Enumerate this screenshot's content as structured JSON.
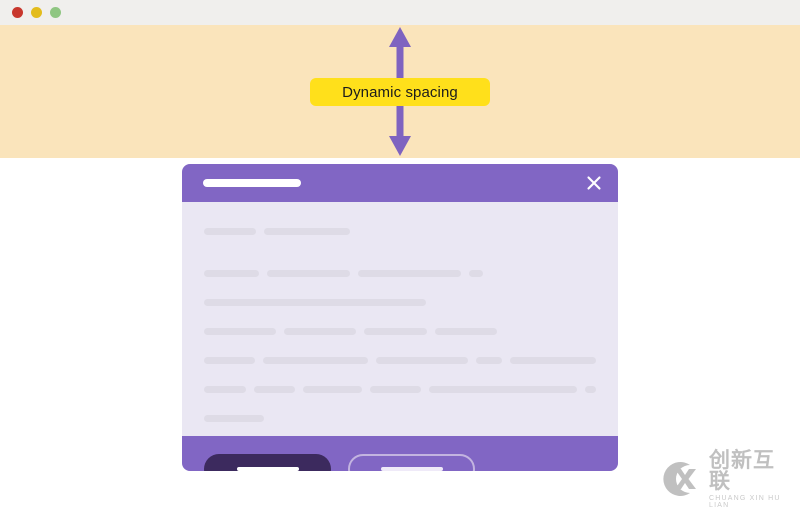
{
  "window": {
    "titlebar": {
      "controls": [
        {
          "name": "close",
          "color": "#c8372d"
        },
        {
          "name": "minimize",
          "color": "#e3bc1c"
        },
        {
          "name": "maximize",
          "color": "#8fc682"
        }
      ]
    }
  },
  "annotation": {
    "band_color": "#fae4bb",
    "arrow_color": "#7e63c0",
    "pill": {
      "label": "Dynamic spacing",
      "background": "#ffe01b",
      "text_color": "#1c1c1c"
    },
    "arrow_icon_top": "arrow-up-icon",
    "arrow_icon_bottom": "arrow-down-icon"
  },
  "modal": {
    "accent_color": "#8166c4",
    "body_color": "#eae7f3",
    "header": {
      "title_placeholder": "",
      "close_icon": "close-icon"
    },
    "body": {
      "skeleton_rows": [
        [
          52,
          86
        ],
        [],
        [
          55,
          83,
          103,
          14
        ],
        [],
        [
          222
        ],
        [],
        [
          72,
          72,
          63,
          62
        ],
        [],
        [
          55,
          112,
          98,
          28,
          92
        ],
        [],
        [
          45,
          45,
          63,
          55,
          160,
          12
        ],
        [],
        [
          60
        ]
      ]
    },
    "footer": {
      "primary_button": {
        "label": "",
        "background": "#3c2a5e",
        "label_bar_color": "#ffffff"
      },
      "secondary_button": {
        "label": "",
        "border_color": "#c3b4e0",
        "label_bar_color": "#efeaf8"
      }
    }
  },
  "watermark": {
    "mark": "cx-logo-icon",
    "chinese": "创新互联",
    "pinyin": "CHUANG XIN HU LIAN",
    "color": "#9b9b9b"
  }
}
